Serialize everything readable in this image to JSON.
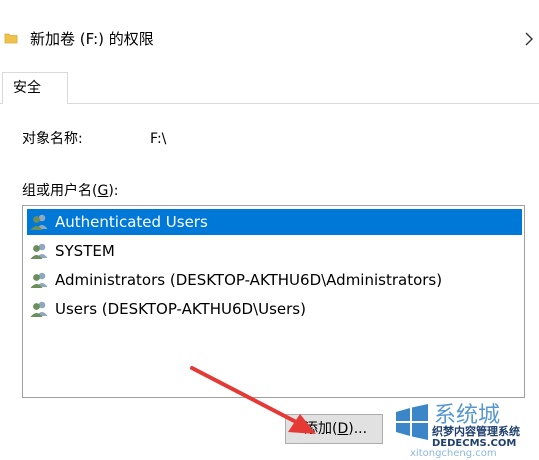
{
  "window": {
    "title": "新加卷 (F:) 的权限"
  },
  "tabs": [
    {
      "label": "安全"
    }
  ],
  "object": {
    "label": "对象名称:",
    "value": "F:\\"
  },
  "groups": {
    "label_prefix": "组或用户名(",
    "label_hotkey": "G",
    "label_suffix": "):",
    "items": [
      {
        "name": "Authenticated Users",
        "selected": true
      },
      {
        "name": "SYSTEM",
        "selected": false
      },
      {
        "name": "Administrators (DESKTOP-AKTHU6D\\Administrators)",
        "selected": false
      },
      {
        "name": "Users (DESKTOP-AKTHU6D\\Users)",
        "selected": false
      }
    ]
  },
  "buttons": {
    "add_prefix": "添加(",
    "add_hotkey": "D",
    "add_suffix": ")..."
  },
  "watermark": {
    "brand_top": "系统城",
    "brand_cn": "织梦内容管理系统",
    "brand_url": "DEDECMS.COM",
    "brand_bottom": "xitongcheng.com"
  },
  "colors": {
    "selection": "#0078d7",
    "arrow": "#e53935",
    "button_bg": "#e1e1e1"
  },
  "icons": {
    "title": "folder-icon",
    "nav": "chevron-right-icon",
    "user": "user-group-icon",
    "logo": "windows-logo-icon"
  }
}
